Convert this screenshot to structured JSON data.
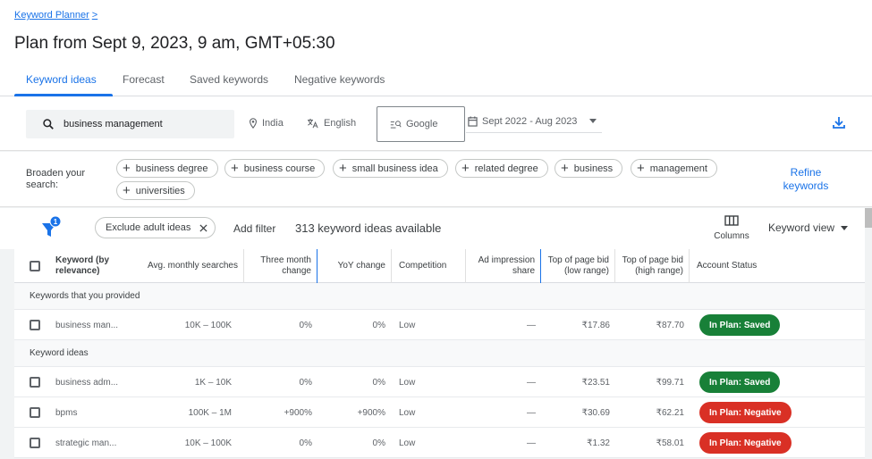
{
  "breadcrumb": {
    "label": "Keyword Planner",
    "chevron": ">"
  },
  "page_title": "Plan from Sept 9, 2023, 9 am, GMT+05:30",
  "tabs": [
    {
      "label": "Keyword ideas",
      "active": true
    },
    {
      "label": "Forecast",
      "active": false
    },
    {
      "label": "Saved keywords",
      "active": false
    },
    {
      "label": "Negative keywords",
      "active": false
    }
  ],
  "filters": {
    "search_value": "business management",
    "location": "India",
    "language": "English",
    "network": "Google",
    "date_range": "Sept 2022 - Aug 2023"
  },
  "broaden": {
    "label": "Broaden your search:",
    "chips": [
      "business degree",
      "business course",
      "small business idea",
      "related degree",
      "business",
      "management",
      "universities"
    ],
    "refine_label": "Refine keywords"
  },
  "toolbar": {
    "filter_count": "1",
    "exclude_chip": "Exclude adult ideas",
    "add_filter": "Add filter",
    "ideas_count": "313 keyword ideas available",
    "columns": "Columns",
    "view": "Keyword view"
  },
  "table": {
    "headers": {
      "keyword": "Keyword (by relevance)",
      "avg": "Avg. monthly searches",
      "three_month": "Three month change",
      "yoy": "YoY change",
      "competition": "Competition",
      "ad_share": "Ad impression share",
      "bid_low": "Top of page bid (low range)",
      "bid_high": "Top of page bid (high range)",
      "status": "Account Status"
    },
    "group_provided": "Keywords that you provided",
    "group_ideas": "Keyword ideas",
    "provided_rows": [
      {
        "keyword": "business man...",
        "avg": "10K – 100K",
        "three": "0%",
        "yoy": "0%",
        "competition": "Low",
        "share": "—",
        "low": "₹17.86",
        "high": "₹87.70",
        "status": "In Plan: Saved",
        "status_color": "#188038"
      }
    ],
    "idea_rows": [
      {
        "keyword": "business adm...",
        "avg": "1K – 10K",
        "three": "0%",
        "yoy": "0%",
        "competition": "Low",
        "share": "—",
        "low": "₹23.51",
        "high": "₹99.71",
        "status": "In Plan: Saved",
        "status_color": "#188038"
      },
      {
        "keyword": "bpms",
        "avg": "100K – 1M",
        "three": "+900%",
        "yoy": "+900%",
        "competition": "Low",
        "share": "—",
        "low": "₹30.69",
        "high": "₹62.21",
        "status": "In Plan: Negative",
        "status_color": "#d93025"
      },
      {
        "keyword": "strategic man...",
        "avg": "10K – 100K",
        "three": "0%",
        "yoy": "0%",
        "competition": "Low",
        "share": "—",
        "low": "₹1.32",
        "high": "₹58.01",
        "status": "In Plan: Negative",
        "status_color": "#d93025"
      }
    ]
  }
}
